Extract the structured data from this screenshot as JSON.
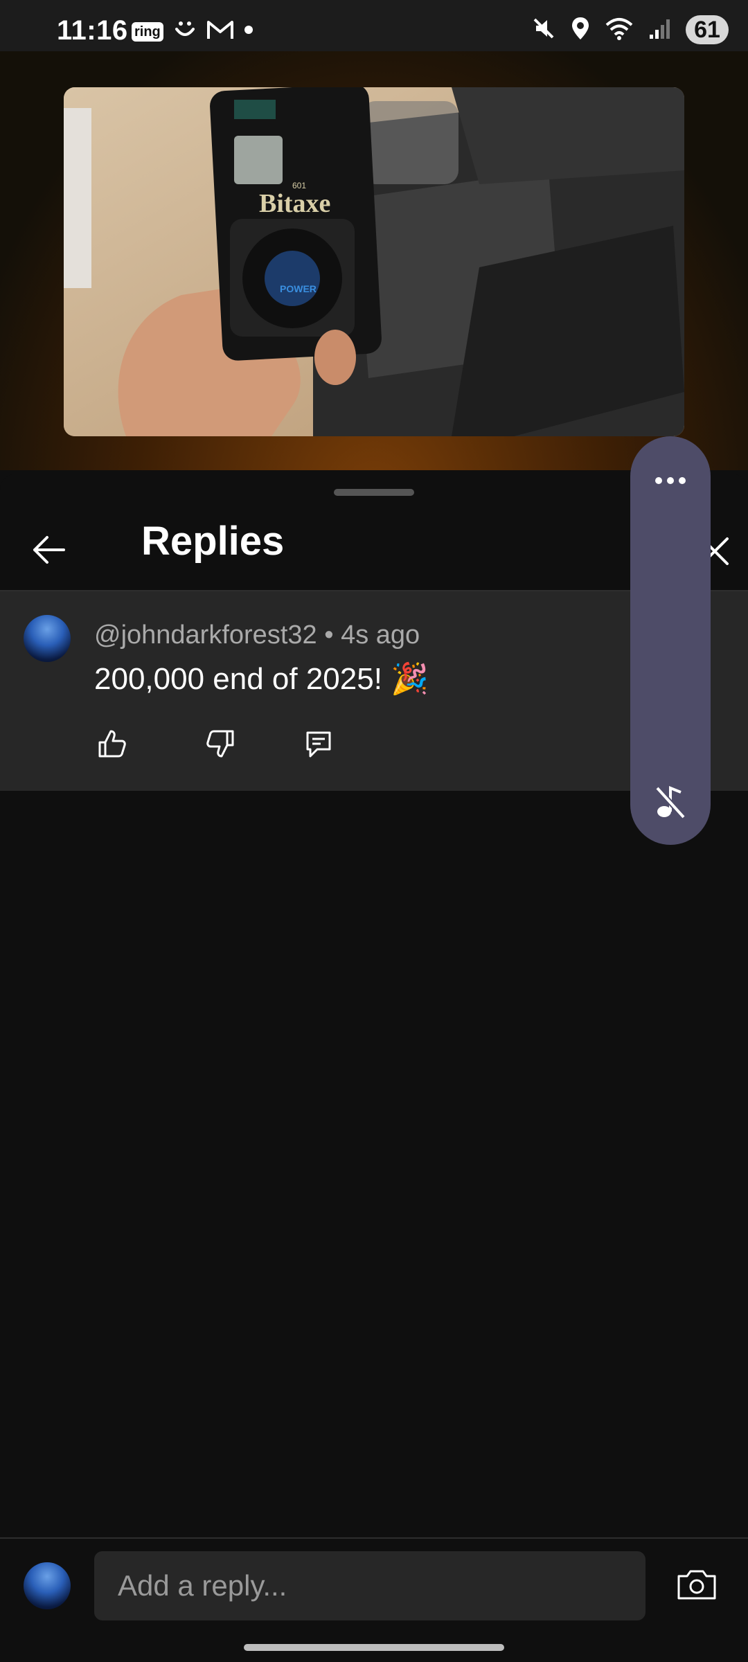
{
  "status_bar": {
    "time": "11:16",
    "ring_label": "ring",
    "battery": "61",
    "icons": [
      "ring-icon",
      "smiley-icon",
      "gmail-icon",
      "dot-icon",
      "mute-icon",
      "location-icon",
      "wifi-icon",
      "signal-icon",
      "battery-icon"
    ]
  },
  "video": {
    "progress_fraction": 0.04,
    "device_label": "Bitaxe",
    "device_model": "601",
    "fan_brand": "POWER"
  },
  "sheet": {
    "title": "Replies",
    "back_icon": "arrow-left-icon",
    "close_icon": "close-icon"
  },
  "comment": {
    "author": "@johndarkforest32",
    "separator": " • ",
    "time_ago": "4s ago",
    "text": "200,000 end of 2025! 🎉",
    "actions": [
      "thumbs-up-icon",
      "thumbs-down-icon",
      "reply-icon"
    ]
  },
  "floating_panel": {
    "more_icon": "more-horizontal-icon",
    "mute_icon": "music-off-icon",
    "color": "#4e4c68"
  },
  "reply_bar": {
    "placeholder": "Add a reply...",
    "camera_icon": "camera-icon"
  },
  "colors": {
    "background": "#0f0f0f",
    "comment_bg": "#272727",
    "secondary_text": "#aaaaaa"
  }
}
